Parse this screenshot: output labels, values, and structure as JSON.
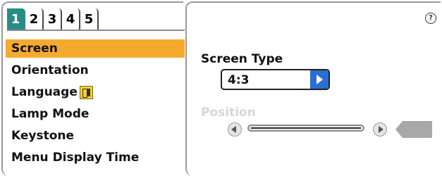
{
  "tabs": [
    {
      "label": "1",
      "active": true
    },
    {
      "label": "2",
      "active": false
    },
    {
      "label": "3",
      "active": false
    },
    {
      "label": "4",
      "active": false
    },
    {
      "label": "5",
      "active": false
    }
  ],
  "menu": {
    "items": [
      {
        "label": "Screen",
        "selected": true
      },
      {
        "label": "Orientation",
        "selected": false
      },
      {
        "label": "Language",
        "selected": false,
        "icon": "language-icon"
      },
      {
        "label": "Lamp Mode",
        "selected": false
      },
      {
        "label": "Keystone",
        "selected": false
      },
      {
        "label": "Menu Display Time",
        "selected": false
      }
    ]
  },
  "help": {
    "icon": "question-icon",
    "label": "?"
  },
  "screen_settings": {
    "screen_type_label": "Screen Type",
    "screen_type_value": "4:3",
    "position_label": "Position",
    "position_enabled": false
  },
  "colors": {
    "active_tab": "#2a8a86",
    "selected_menu": "#f5aa2e",
    "select_arrow": "#2a6fd0",
    "disabled_text": "#d6d6d6"
  }
}
